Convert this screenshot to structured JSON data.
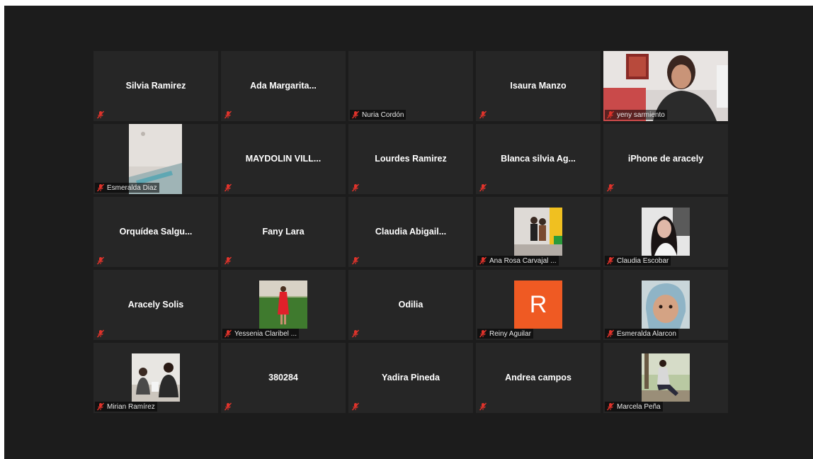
{
  "meeting": {
    "participants": [
      {
        "tile_name": "Silvia Ramirez",
        "label": ""
      },
      {
        "tile_name": "Ada  Margarita...",
        "label": ""
      },
      {
        "tile_name": "",
        "label": "Nuria Cordón"
      },
      {
        "tile_name": "Isaura Manzo",
        "label": ""
      },
      {
        "tile_name": "",
        "label": "yeny sarmiento",
        "video": "webcam-woman"
      },
      {
        "tile_name": "",
        "label": "Esmeralda Diaz",
        "video": "ceiling-photo"
      },
      {
        "tile_name": "MAYDOLIN  VILL...",
        "label": ""
      },
      {
        "tile_name": "Lourdes Ramirez",
        "label": ""
      },
      {
        "tile_name": "Blanca  silvia  Ag...",
        "label": ""
      },
      {
        "tile_name": "iPhone de aracely",
        "label": ""
      },
      {
        "tile_name": "Orquídea  Salgu...",
        "label": ""
      },
      {
        "tile_name": "Fany Lara",
        "label": ""
      },
      {
        "tile_name": "Claudia  Abigail...",
        "label": ""
      },
      {
        "tile_name": "",
        "label": "Ana Rosa Carvajal ...",
        "video": "two-women-photo"
      },
      {
        "tile_name": "",
        "label": "Claudia Escobar",
        "video": "woman-portrait"
      },
      {
        "tile_name": "Aracely Solis",
        "label": ""
      },
      {
        "tile_name": "",
        "label": "Yessenia Claribel ...",
        "video": "red-dress-photo"
      },
      {
        "tile_name": "Odilia",
        "label": ""
      },
      {
        "tile_name": "",
        "label": "Reiny Aguilar",
        "avatar_letter": "R",
        "avatar_color": "#ef5a23"
      },
      {
        "tile_name": "",
        "label": "Esmeralda Alarcon",
        "video": "baby-photo"
      },
      {
        "tile_name": "",
        "label": "Mirian Ramírez",
        "video": "couple-photo"
      },
      {
        "tile_name": "380284",
        "label": ""
      },
      {
        "tile_name": "Yadira Pineda",
        "label": ""
      },
      {
        "tile_name": "Andrea campos",
        "label": ""
      },
      {
        "tile_name": "",
        "label": "Marcela Peña",
        "video": "outdoor-woman-photo"
      }
    ]
  },
  "colors": {
    "background": "#1c1c1c",
    "tile": "#262626",
    "muted_icon": "#e0332b"
  }
}
